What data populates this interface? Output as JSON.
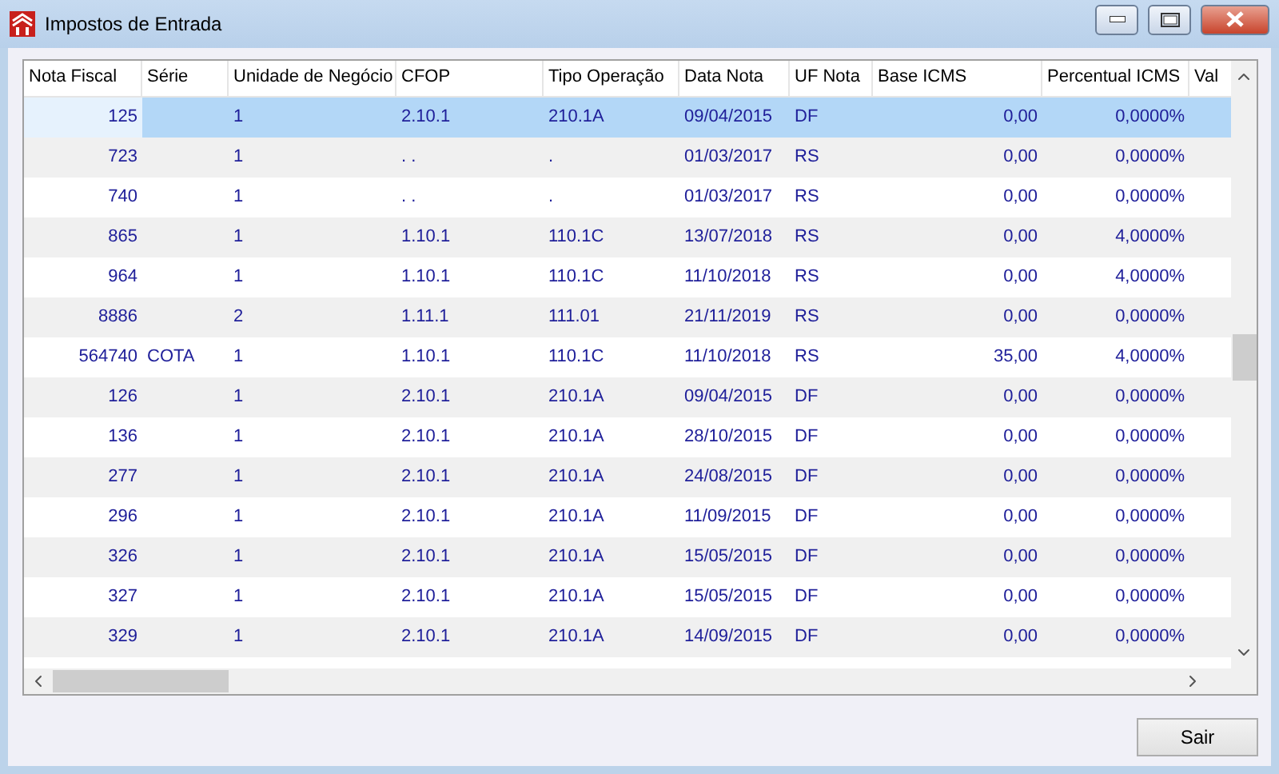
{
  "window": {
    "title": "Impostos de Entrada"
  },
  "table": {
    "columns": [
      "Nota Fiscal",
      "Série",
      "Unidade de Negócio",
      "CFOP",
      "Tipo Operação",
      "Data Nota",
      "UF Nota",
      "Base ICMS",
      "Percentual ICMS",
      "Val"
    ],
    "rows": [
      {
        "selected": true,
        "nota": "125",
        "unidade": "1",
        "cfop": "2.10.1",
        "tipo": "210.1A",
        "data": "09/04/2015",
        "uf": "DF",
        "base": "0,00",
        "percentual": "0,0000%"
      },
      {
        "selected": false,
        "nota": "723",
        "unidade": "1",
        "cfop": ". .",
        "tipo": ".",
        "data": "01/03/2017",
        "uf": "RS",
        "base": "0,00",
        "percentual": "0,0000%"
      },
      {
        "selected": false,
        "nota": "740",
        "unidade": "1",
        "cfop": ". .",
        "tipo": ".",
        "data": "01/03/2017",
        "uf": "RS",
        "base": "0,00",
        "percentual": "0,0000%"
      },
      {
        "selected": false,
        "nota": "865",
        "unidade": "1",
        "cfop": "1.10.1",
        "tipo": "110.1C",
        "data": "13/07/2018",
        "uf": "RS",
        "base": "0,00",
        "percentual": "4,0000%"
      },
      {
        "selected": false,
        "nota": "964",
        "unidade": "1",
        "cfop": "1.10.1",
        "tipo": "110.1C",
        "data": "11/10/2018",
        "uf": "RS",
        "base": "0,00",
        "percentual": "4,0000%"
      },
      {
        "selected": false,
        "nota": "8886",
        "unidade": "2",
        "cfop": "1.11.1",
        "tipo": "111.01",
        "data": "21/11/2019",
        "uf": "RS",
        "base": "0,00",
        "percentual": "0,0000%"
      },
      {
        "selected": false,
        "nota": "564740",
        "serie": "COTA",
        "unidade": "1",
        "cfop": "1.10.1",
        "tipo": "110.1C",
        "data": "11/10/2018",
        "uf": "RS",
        "base": "35,00",
        "percentual": "4,0000%"
      },
      {
        "selected": false,
        "nota": "126",
        "unidade": "1",
        "cfop": "2.10.1",
        "tipo": "210.1A",
        "data": "09/04/2015",
        "uf": "DF",
        "base": "0,00",
        "percentual": "0,0000%"
      },
      {
        "selected": false,
        "nota": "136",
        "unidade": "1",
        "cfop": "2.10.1",
        "tipo": "210.1A",
        "data": "28/10/2015",
        "uf": "DF",
        "base": "0,00",
        "percentual": "0,0000%"
      },
      {
        "selected": false,
        "nota": "277",
        "unidade": "1",
        "cfop": "2.10.1",
        "tipo": "210.1A",
        "data": "24/08/2015",
        "uf": "DF",
        "base": "0,00",
        "percentual": "0,0000%"
      },
      {
        "selected": false,
        "nota": "296",
        "unidade": "1",
        "cfop": "2.10.1",
        "tipo": "210.1A",
        "data": "11/09/2015",
        "uf": "DF",
        "base": "0,00",
        "percentual": "0,0000%"
      },
      {
        "selected": false,
        "nota": "326",
        "unidade": "1",
        "cfop": "2.10.1",
        "tipo": "210.1A",
        "data": "15/05/2015",
        "uf": "DF",
        "base": "0,00",
        "percentual": "0,0000%"
      },
      {
        "selected": false,
        "nota": "327",
        "unidade": "1",
        "cfop": "2.10.1",
        "tipo": "210.1A",
        "data": "15/05/2015",
        "uf": "DF",
        "base": "0,00",
        "percentual": "0,0000%"
      },
      {
        "selected": false,
        "nota": "329",
        "unidade": "1",
        "cfop": "2.10.1",
        "tipo": "210.1A",
        "data": "14/09/2015",
        "uf": "DF",
        "base": "0,00",
        "percentual": "0,0000%"
      }
    ]
  },
  "buttons": [
    {
      "label": "Sair"
    }
  ]
}
